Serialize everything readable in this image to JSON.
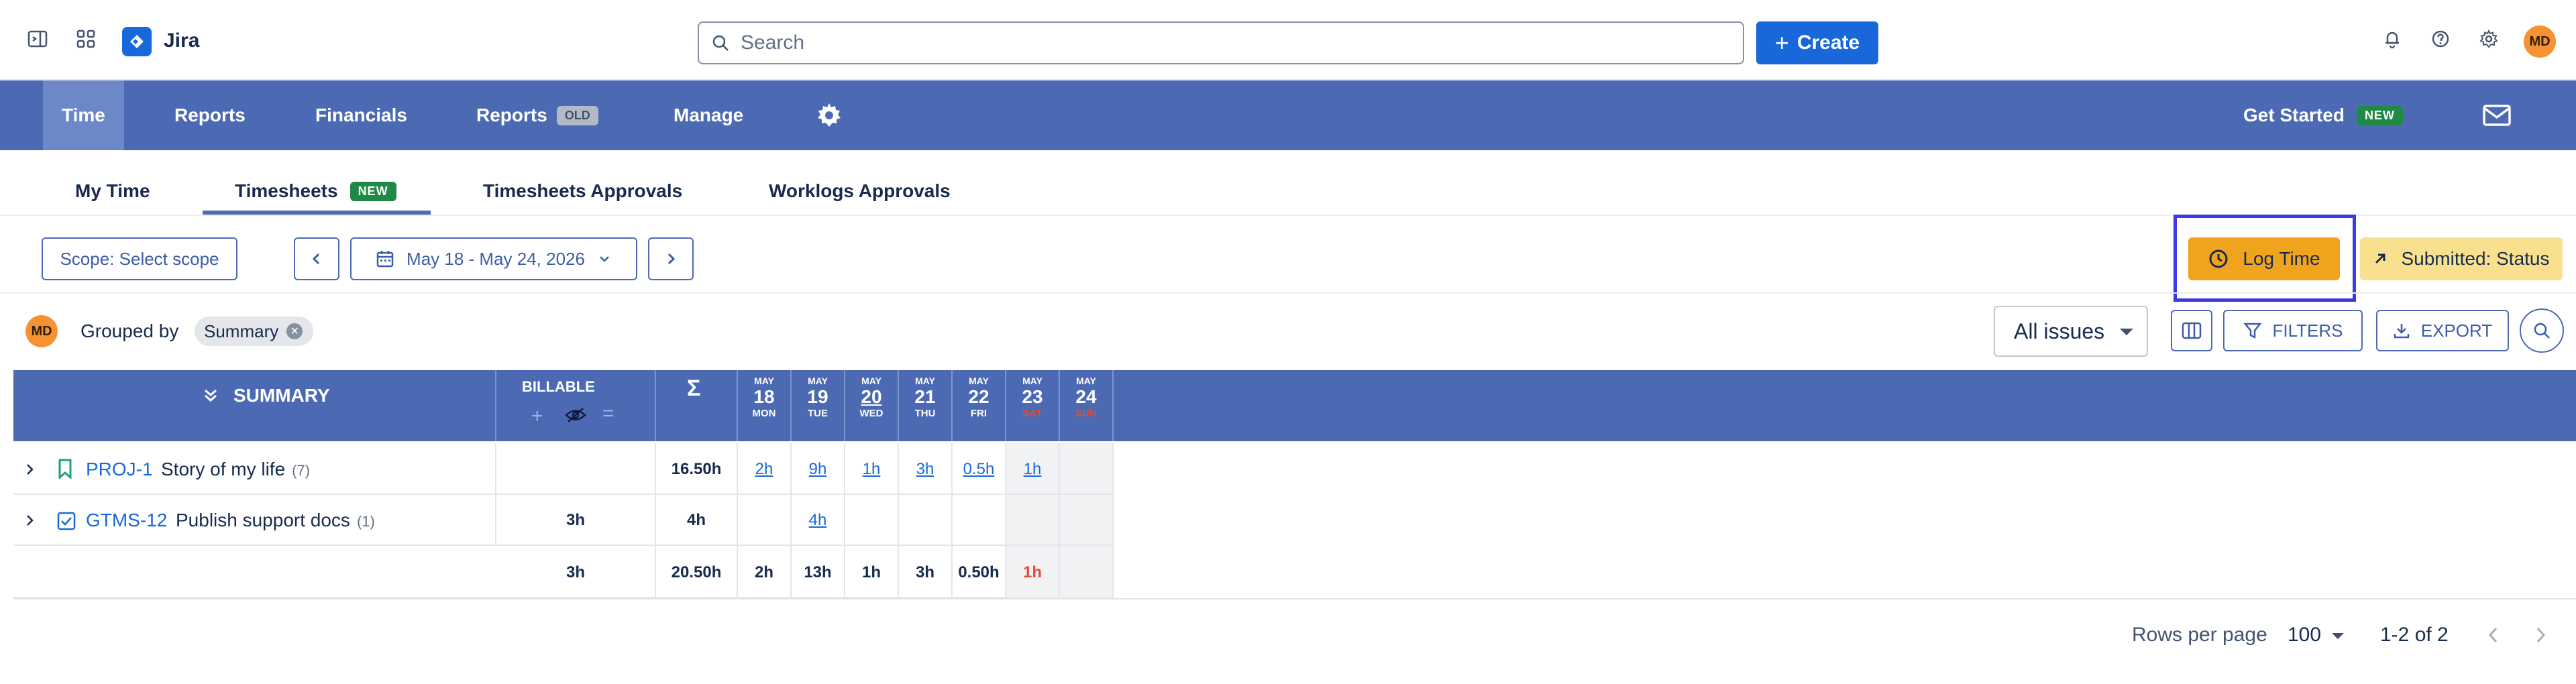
{
  "topbar": {
    "brand": "Jira",
    "search_placeholder": "Search",
    "create_label": "Create",
    "avatar_initials": "MD"
  },
  "appnav": {
    "items": [
      {
        "label": "Time",
        "active": true
      },
      {
        "label": "Reports"
      },
      {
        "label": "Financials"
      },
      {
        "label": "Reports",
        "badge": "OLD"
      },
      {
        "label": "Manage"
      }
    ],
    "get_started_label": "Get Started",
    "get_started_badge": "NEW"
  },
  "tabs": [
    {
      "label": "My Time"
    },
    {
      "label": "Timesheets",
      "badge": "NEW",
      "active": true
    },
    {
      "label": "Timesheets Approvals"
    },
    {
      "label": "Worklogs Approvals"
    }
  ],
  "toolbar": {
    "scope_label": "Scope: Select scope",
    "date_range": "May 18 - May 24, 2026",
    "log_time_label": "Log Time",
    "submitted_label": "Submitted: Status"
  },
  "grouping": {
    "avatar_initials": "MD",
    "grouped_by_label": "Grouped by",
    "chip_label": "Summary",
    "issues_select": "All issues",
    "filters_label": "FILTERS",
    "export_label": "EXPORT"
  },
  "table": {
    "headers": {
      "summary": "SUMMARY",
      "billable": "BILLABLE",
      "total": "Σ"
    },
    "days": [
      {
        "month": "MAY",
        "day": "18",
        "weekday": "MON"
      },
      {
        "month": "MAY",
        "day": "19",
        "weekday": "TUE"
      },
      {
        "month": "MAY",
        "day": "20",
        "weekday": "WED",
        "today": true
      },
      {
        "month": "MAY",
        "day": "21",
        "weekday": "THU"
      },
      {
        "month": "MAY",
        "day": "22",
        "weekday": "FRI"
      },
      {
        "month": "MAY",
        "day": "23",
        "weekday": "SAT",
        "weekend": true
      },
      {
        "month": "MAY",
        "day": "24",
        "weekday": "SUN",
        "weekend": true
      }
    ],
    "rows": [
      {
        "key": "PROJ-1",
        "title": "Story of my life",
        "count": "(7)",
        "billable": "",
        "total": "16.50h",
        "cells": [
          "2h",
          "9h",
          "1h",
          "3h",
          "0.5h",
          "1h",
          ""
        ]
      },
      {
        "key": "GTMS-12",
        "title": "Publish support docs",
        "count": "(1)",
        "billable": "3h",
        "total": "4h",
        "cells": [
          "",
          "4h",
          "",
          "",
          "",
          "",
          ""
        ]
      }
    ],
    "totals": {
      "billable": "3h",
      "total": "20.50h",
      "cells": [
        "2h",
        "13h",
        "1h",
        "3h",
        "0.50h",
        "1h",
        ""
      ]
    }
  },
  "footer": {
    "rows_per_page_label": "Rows per page",
    "rows_per_page_value": "100",
    "range_label": "1-2 of 2"
  },
  "colors": {
    "nav_bg": "#4c6ab4",
    "primary": "#1868db",
    "log_time_bg": "#f0a41e",
    "submitted_bg": "#f8e08e",
    "weekend_text": "#e14c3d",
    "highlight": "#3a3ae6"
  }
}
